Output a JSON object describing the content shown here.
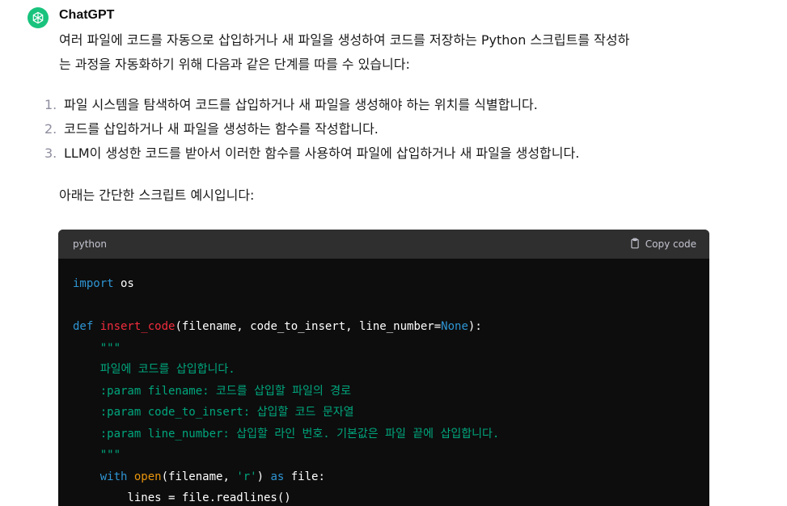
{
  "author": "ChatGPT",
  "intro": "여러 파일에 코드를 자동으로 삽입하거나 새 파일을 생성하여 코드를 저장하는 Python 스크립트를 작성하는 과정을 자동화하기 위해 다음과 같은 단계를 따를 수 있습니다:",
  "intro_line1": "여러 파일에 코드를 자동으로 삽입하거나 새 파일을 생성하여 코드를 저장하는 Python 스크립트를 작성하",
  "intro_line2": "는 과정을 자동화하기 위해 다음과 같은 단계를 따를 수 있습니다:",
  "steps": [
    {
      "num": "1.",
      "text": "파일 시스템을 탐색하여 코드를 삽입하거나 새 파일을 생성해야 하는 위치를 식별합니다."
    },
    {
      "num": "2.",
      "text": "코드를 삽입하거나 새 파일을 생성하는 함수를 작성합니다."
    },
    {
      "num": "3.",
      "text": "LLM이 생성한 코드를 받아서 이러한 함수를 사용하여 파일에 삽입하거나 새 파일을 생성합니다."
    }
  ],
  "example_intro": "아래는 간단한 스크립트 예시입니다:",
  "code": {
    "language": "python",
    "copy_label": "Copy code",
    "lines": [
      [
        {
          "t": "import",
          "c": "kw"
        },
        {
          "t": " os",
          "c": "plain"
        }
      ],
      [],
      [
        {
          "t": "def ",
          "c": "kw"
        },
        {
          "t": "insert_code",
          "c": "fn"
        },
        {
          "t": "(filename, code_to_insert, line_number=",
          "c": "plain"
        },
        {
          "t": "None",
          "c": "kw"
        },
        {
          "t": "):",
          "c": "plain"
        }
      ],
      [
        {
          "t": "    \"\"\"",
          "c": "str"
        }
      ],
      [
        {
          "t": "    파일에 코드를 삽입합니다.",
          "c": "str"
        }
      ],
      [
        {
          "t": "    :param filename: 코드를 삽입할 파일의 경로",
          "c": "str"
        }
      ],
      [
        {
          "t": "    :param code_to_insert: 삽입할 코드 문자열",
          "c": "str"
        }
      ],
      [
        {
          "t": "    :param line_number: 삽입할 라인 번호. 기본값은 파일 끝에 삽입합니다.",
          "c": "str"
        }
      ],
      [
        {
          "t": "    \"\"\"",
          "c": "str"
        }
      ],
      [
        {
          "t": "    ",
          "c": "plain"
        },
        {
          "t": "with",
          "c": "kw"
        },
        {
          "t": " ",
          "c": "plain"
        },
        {
          "t": "open",
          "c": "builtin"
        },
        {
          "t": "(filename, ",
          "c": "plain"
        },
        {
          "t": "'r'",
          "c": "str"
        },
        {
          "t": ") ",
          "c": "plain"
        },
        {
          "t": "as",
          "c": "kw"
        },
        {
          "t": " file:",
          "c": "plain"
        }
      ],
      [
        {
          "t": "        lines = file.readlines()",
          "c": "plain"
        }
      ]
    ]
  },
  "colors": {
    "avatar_bg": "#19c37d",
    "code_bg": "#0d0d0d",
    "code_header_bg": "#2f2f2f",
    "keyword": "#2e95d3",
    "function": "#f22c3d",
    "string": "#00a67d"
  },
  "icons": {
    "avatar": "openai-logo-icon",
    "copy": "clipboard-icon"
  }
}
